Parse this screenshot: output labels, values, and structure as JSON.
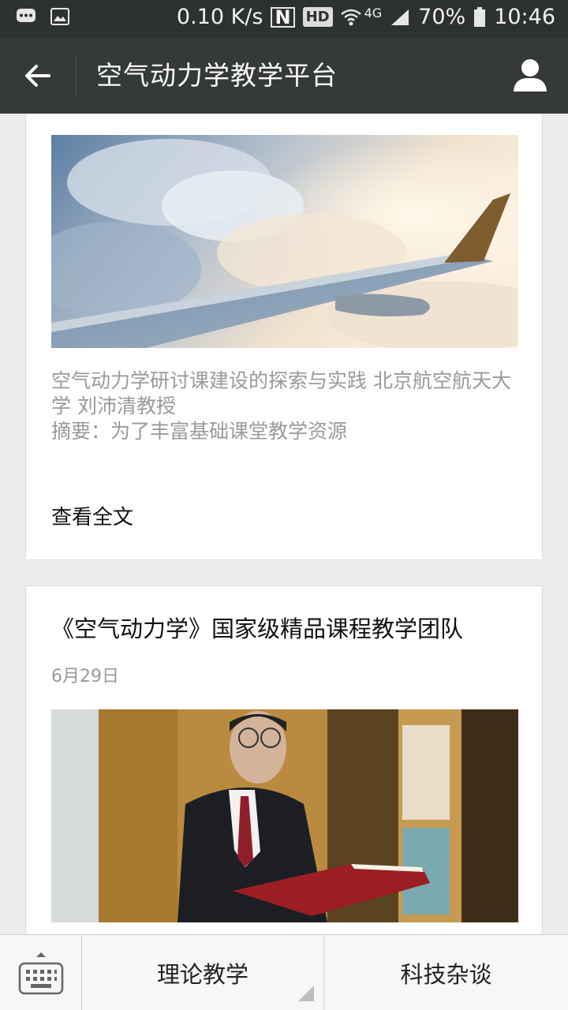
{
  "status_bar": {
    "speed": "0.10 K/s",
    "nfc": "N",
    "hd": "HD",
    "network": "4G",
    "battery": "70%",
    "time": "10:46",
    "icons": [
      "message-icon",
      "image-icon",
      "wifi-icon",
      "signal-icon",
      "battery-icon"
    ]
  },
  "header": {
    "title": "空气动力学教学平台",
    "back_icon": "back-arrow-icon",
    "profile_icon": "user-profile-icon"
  },
  "articles": [
    {
      "image": "airplane-wing-clouds",
      "summary": "空气动力学研讨课建设的探索与实践 北京航空航天大学 刘沛清教授\n摘要：为了丰富基础课堂教学资源",
      "read_more": "查看全文"
    },
    {
      "title": "《空气动力学》国家级精品课程教学团队",
      "date": "6月29日",
      "image": "professor-holding-book"
    }
  ],
  "bottom_menu": {
    "keyboard_icon": "keyboard-icon",
    "items": [
      {
        "label": "理论教学"
      },
      {
        "label": "科技杂谈"
      }
    ]
  },
  "colors": {
    "status_bar_bg": "#2e3132",
    "app_bar_bg": "#36393a",
    "page_bg": "#ececec",
    "summary_text": "#9a9a9a"
  }
}
